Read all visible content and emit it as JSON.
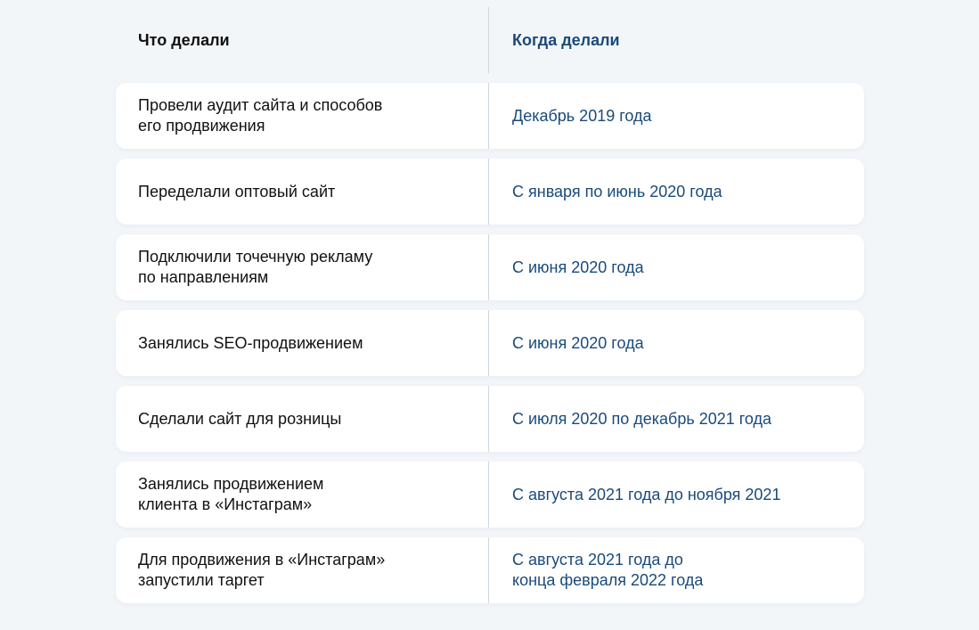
{
  "header": {
    "what": "Что делали",
    "when": "Когда делали"
  },
  "rows": [
    {
      "what": "Провели аудит сайта и способов\nего продвижения",
      "when": "Декабрь 2019 года"
    },
    {
      "what": "Переделали оптовый сайт",
      "when": "С января по июнь 2020 года"
    },
    {
      "what": "Подключили точечную рекламу\nпо направлениям",
      "when": "С июня 2020 года"
    },
    {
      "what": "Занялись SEO-продвижением",
      "when": "С июня 2020 года"
    },
    {
      "what": "Сделали сайт для розницы",
      "when": "С июля 2020 по декабрь 2021 года"
    },
    {
      "what": "Занялись продвижением\nклиента в «Инстаграм»",
      "when": "С августа 2021 года до ноября 2021"
    },
    {
      "what": "Для продвижения в «Инстаграм»\nзапустили таргет",
      "when": "С августа 2021 года до\nконца февраля 2022 года"
    }
  ],
  "colors": {
    "background": "#f3f6f9",
    "card": "#ffffff",
    "text": "#111111",
    "accent": "#1a4a7a",
    "divider": "#cfd8e0"
  }
}
